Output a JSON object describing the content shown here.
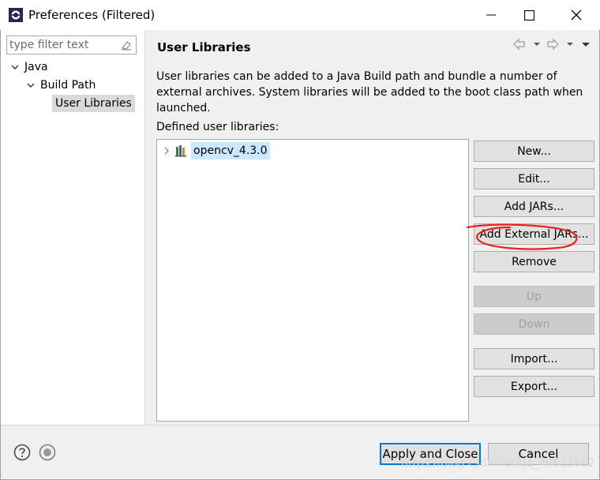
{
  "window": {
    "title": "Preferences (Filtered)",
    "minimize_icon": "minimize-icon",
    "maximize_icon": "maximize-icon",
    "close_icon": "close-icon"
  },
  "filter": {
    "placeholder": "type filter text"
  },
  "nav": {
    "items": [
      {
        "label": "Java"
      },
      {
        "label": "Build Path"
      },
      {
        "label": "User Libraries"
      }
    ]
  },
  "page": {
    "title": "User Libraries",
    "description": "User libraries can be added to a Java Build path and bundle a number of external archives. System libraries will be added to the boot class path when launched.",
    "list_label": "Defined user libraries:",
    "libraries": [
      {
        "name": "opencv_4.3.0"
      }
    ]
  },
  "buttons": {
    "new": "New...",
    "edit": "Edit...",
    "add_jars": "Add JARs...",
    "add_external_jars": "Add External JARs...",
    "remove": "Remove",
    "up": "Up",
    "down": "Down",
    "import": "Import...",
    "export": "Export..."
  },
  "footer": {
    "apply_close": "Apply and Close",
    "cancel": "Cancel",
    "watermark": "https://blog.csdn.net/qq_40811682"
  },
  "colors": {
    "accent": "#0078d7",
    "selection": "#cce8ff",
    "annotation": "#e8231b"
  }
}
